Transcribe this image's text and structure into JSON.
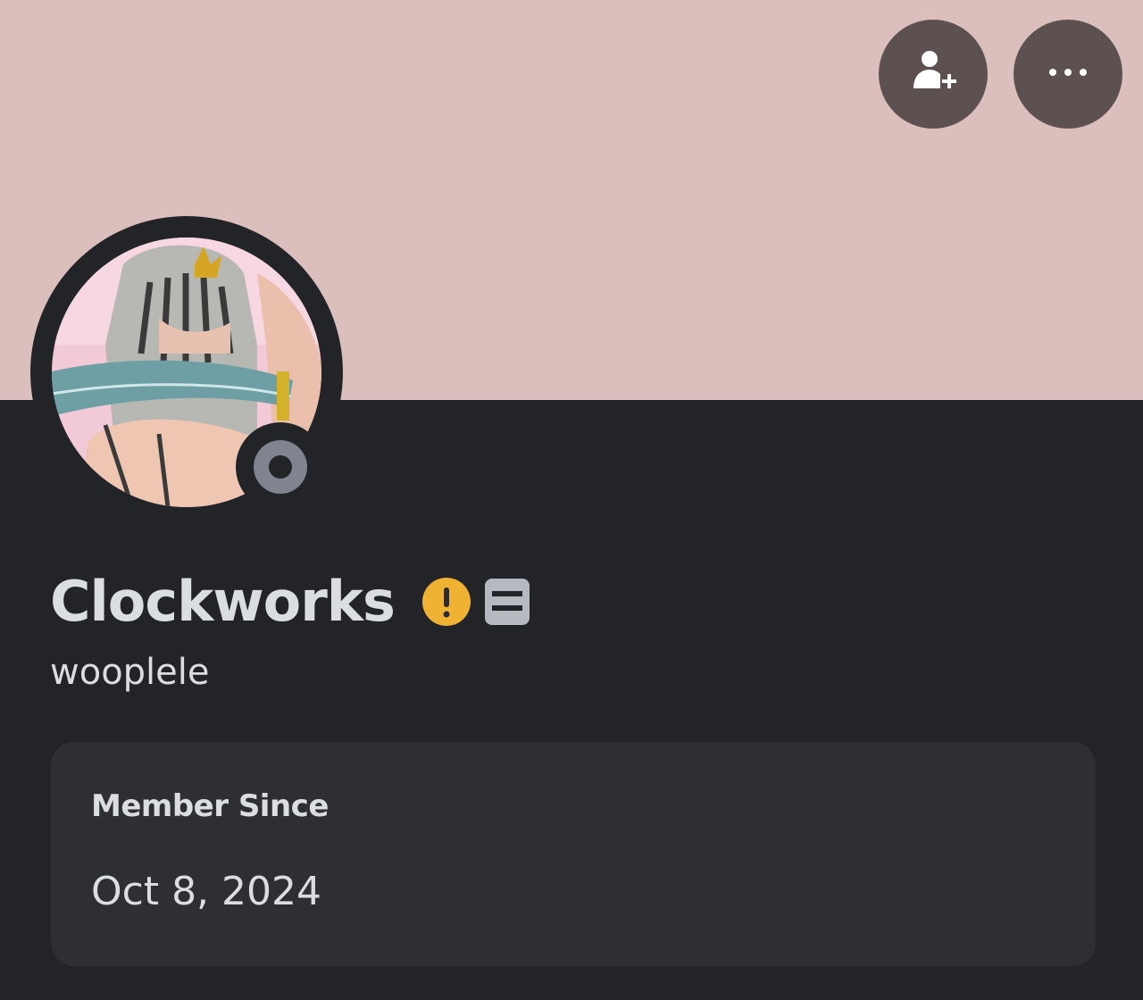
{
  "banner": {
    "color": "#dabfbc",
    "actions": [
      {
        "name": "add-friend-button",
        "icon": "add-friend-icon"
      },
      {
        "name": "more-options-button",
        "icon": "more-horizontal-icon"
      }
    ]
  },
  "avatar": {
    "status": "offline",
    "status_color": "#80848e"
  },
  "profile": {
    "display_name": "Clockworks",
    "username": "wooplele",
    "badges": [
      {
        "icon": "warning-icon",
        "color": "#f0b232"
      },
      {
        "icon": "id-card-icon",
        "color": "#b5bac1"
      }
    ]
  },
  "info_card": {
    "label": "Member Since",
    "value": "Oct 8, 2024"
  },
  "colors": {
    "background": "#232428",
    "card": "#2e2f34",
    "text": "#dbdee1",
    "button": "#5c5150"
  }
}
